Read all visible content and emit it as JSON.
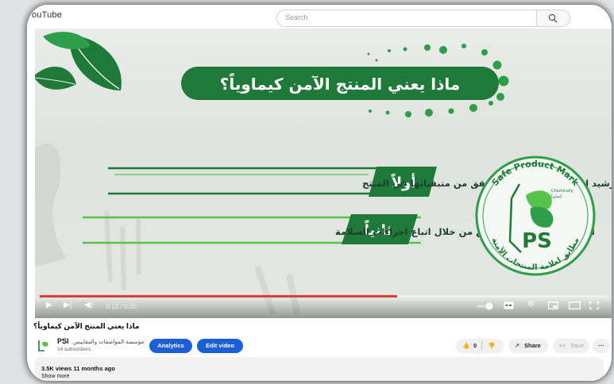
{
  "header": {
    "logo_text": "ouTube",
    "search_placeholder": "Search",
    "search_icon": "search-icon"
  },
  "video": {
    "heading": "ماذا يعني المنتج الآمن كيماوياً؟",
    "point1_label": "أولاً",
    "point1_text": "ترشيد استهلال المبيدات والتحقق من متبقياتها في المنتج",
    "point2_label": "ثانياً",
    "point2_text": "الحفاظ على صحة العاملين من خلال اتباع اجراءات السلامة",
    "badge_top": "Safe Product Mark",
    "badge_bottom": "مطابق لعلامة المنتجات الآمنة",
    "badge_small": "Chemically",
    "badge_small_ar": "كيماوياً",
    "badge_center": "PS",
    "progress": 0.63,
    "timecode": "0:12 / 0:20",
    "colors": {
      "green_dark": "#1f7a3a",
      "green": "#2e9e4a",
      "green_light": "#57c34b"
    }
  },
  "details": {
    "title": "ماذا يعني المنتج الآمن كيماوياً؟",
    "channel_name": "PSI",
    "channel_name_ar": "مؤسسة المواصفات والمقاييس",
    "subscribers": "14 subscribers",
    "analytics_label": "Analytics",
    "edit_label": "Edit video",
    "like_count": "0",
    "share_label": "Share",
    "save_label": "Save",
    "more_label": "···",
    "views": "3.5K views  11 months ago",
    "show_more": "Show more"
  }
}
